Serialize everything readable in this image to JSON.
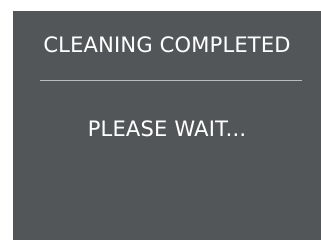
{
  "screen": {
    "title": "CLEANING COMPLETED",
    "message": "PLEASE WAIT..."
  },
  "colors": {
    "screen_background": "#535658",
    "text": "#ffffff",
    "divider": "#b9bcbe"
  }
}
